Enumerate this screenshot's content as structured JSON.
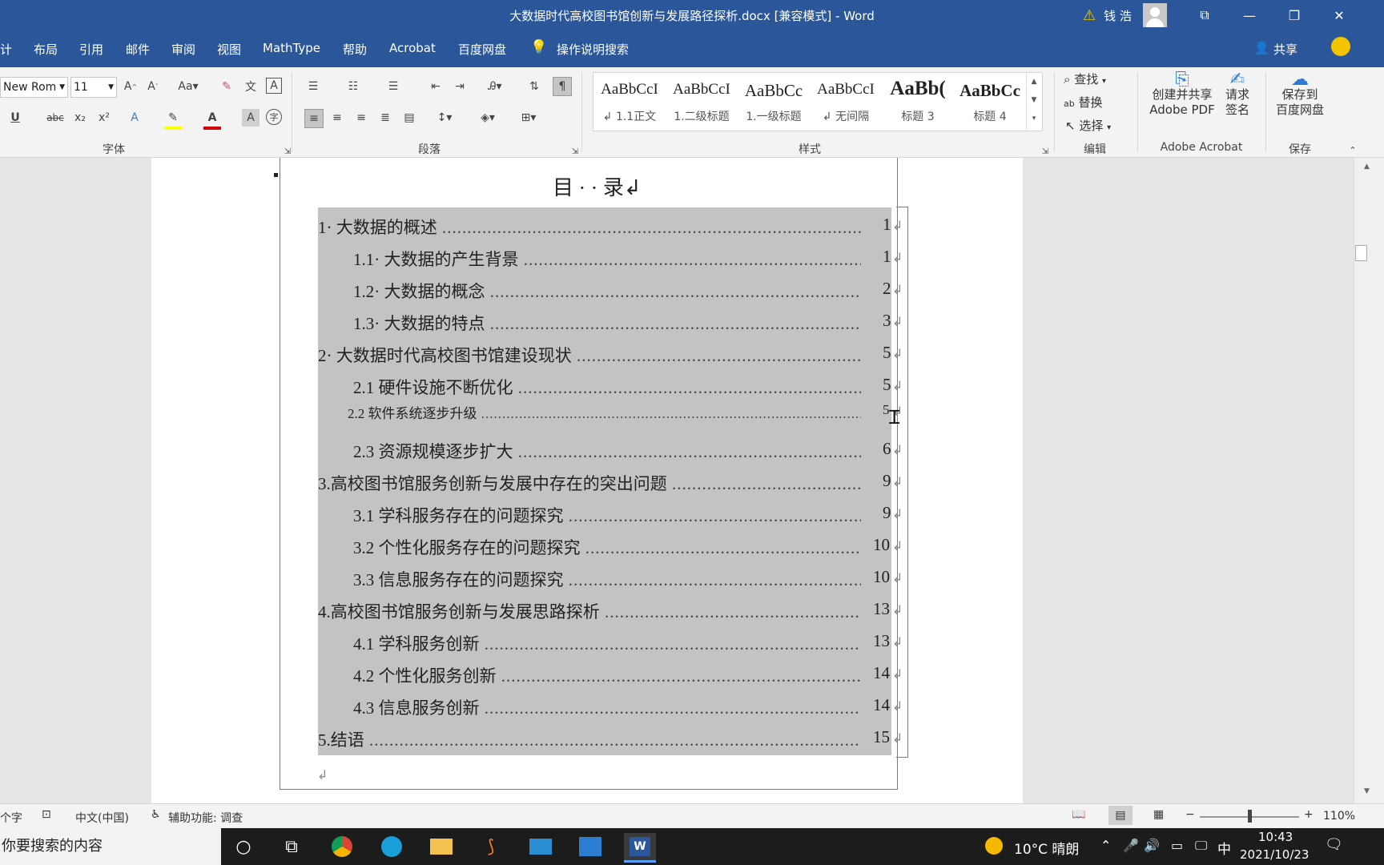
{
  "window": {
    "title": "大数据时代高校图书馆创新与发展路径探析.docx [兼容模式]  -  Word",
    "user": "钱 浩",
    "warning_icon": "warning-icon",
    "buttons": [
      "ribbon-display-icon",
      "minimize-icon",
      "restore-icon",
      "close-icon"
    ]
  },
  "menu": {
    "items": [
      "计",
      "布局",
      "引用",
      "邮件",
      "审阅",
      "视图",
      "MathType",
      "帮助",
      "Acrobat",
      "百度网盘"
    ],
    "tell_me": "操作说明搜索",
    "share": "共享"
  },
  "ribbon": {
    "font": {
      "name": "New Rom",
      "size": "11",
      "group_label": "字体"
    },
    "paragraph": {
      "group_label": "段落"
    },
    "styles": {
      "group_label": "样式",
      "items": [
        {
          "preview": "AaBbCcI",
          "name": "↲ 1.1正文"
        },
        {
          "preview": "AaBbCcI",
          "name": "1.二级标题"
        },
        {
          "preview": "AaBbCc",
          "name": "1.一级标题"
        },
        {
          "preview": "AaBbCcI",
          "name": "↲ 无间隔"
        },
        {
          "preview": "AaBb(",
          "name": "标题 3"
        },
        {
          "preview": "AaBbCc",
          "name": "标题 4"
        }
      ]
    },
    "editing": {
      "group_label": "编辑",
      "find": "查找",
      "replace": "替换",
      "select": "选择"
    },
    "acrobat": {
      "group_label": "Adobe Acrobat",
      "create_share": "创建并共享",
      "adobe_pdf": "Adobe PDF",
      "request": "请求",
      "sign": "签名"
    },
    "save": {
      "group_label": "保存",
      "save_to": "保存到",
      "baidu": "百度网盘"
    }
  },
  "document": {
    "heading": "目 · · 录↲",
    "toc": [
      {
        "label": "1· 大数据的概述",
        "page": "1",
        "level": 1
      },
      {
        "label": "1.1· 大数据的产生背景",
        "page": "1",
        "level": 2
      },
      {
        "label": "1.2· 大数据的概念",
        "page": "2",
        "level": 2
      },
      {
        "label": "1.3· 大数据的特点",
        "page": "3",
        "level": 2
      },
      {
        "label": "2· 大数据时代高校图书馆建设现状",
        "page": "5",
        "level": 1
      },
      {
        "label": "2.1 硬件设施不断优化",
        "page": "5",
        "level": 2
      },
      {
        "label": "2.2 软件系统逐步升级",
        "page": "5",
        "level": 3
      },
      {
        "label": "2.3 资源规模逐步扩大",
        "page": "6",
        "level": 2
      },
      {
        "label": "3.高校图书馆服务创新与发展中存在的突出问题",
        "page": "9",
        "level": 1
      },
      {
        "label": "3.1 学科服务存在的问题探究",
        "page": "9",
        "level": 2
      },
      {
        "label": "3.2 个性化服务存在的问题探究",
        "page": "10",
        "level": 2
      },
      {
        "label": "3.3 信息服务存在的问题探究",
        "page": "10",
        "level": 2
      },
      {
        "label": "4.高校图书馆服务创新与发展思路探析",
        "page": "13",
        "level": 1
      },
      {
        "label": "4.1 学科服务创新",
        "page": "13",
        "level": 2
      },
      {
        "label": "4.2 个性化服务创新",
        "page": "14",
        "level": 2
      },
      {
        "label": "4.3 信息服务创新",
        "page": "14",
        "level": 2
      },
      {
        "label": "5.结语",
        "page": "15",
        "level": 1
      }
    ],
    "para_mark": "↲"
  },
  "status": {
    "words": "个字",
    "language": "中文(中国)",
    "accessibility": "辅助功能: 调查",
    "zoom": "110%"
  },
  "taskbar": {
    "search": "你要搜索的内容",
    "weather": "10°C  晴朗",
    "ime": "中",
    "time": "10:43",
    "date": "2021/10/23"
  }
}
